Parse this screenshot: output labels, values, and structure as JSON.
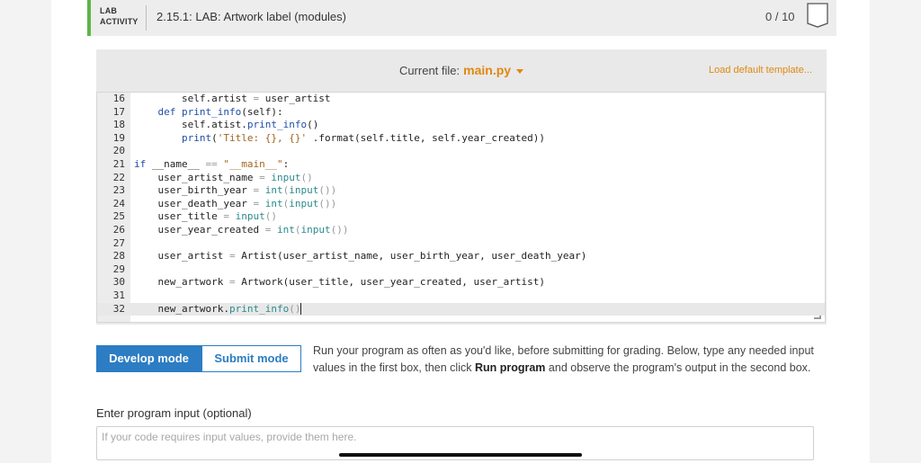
{
  "header": {
    "lab_tag_line1": "LAB",
    "lab_tag_line2": "ACTIVITY",
    "title": "2.15.1: LAB: Artwork label (modules)",
    "score": "0 / 10",
    "accent_color": "#5db548"
  },
  "editor": {
    "current_file_label": "Current file:",
    "file_name": "main.py",
    "load_template": "Load default template...",
    "lines": [
      {
        "n": "16",
        "segs": [
          {
            "t": "        self.artist ",
            "c": ""
          },
          {
            "t": "=",
            "c": "p"
          },
          {
            "t": " user_artist",
            "c": ""
          }
        ]
      },
      {
        "n": "17",
        "segs": [
          {
            "t": "    ",
            "c": ""
          },
          {
            "t": "def",
            "c": "k"
          },
          {
            "t": " ",
            "c": ""
          },
          {
            "t": "print_info",
            "c": "f"
          },
          {
            "t": "(self):",
            "c": ""
          }
        ]
      },
      {
        "n": "18",
        "segs": [
          {
            "t": "        self.atist.",
            "c": ""
          },
          {
            "t": "print_info",
            "c": "f"
          },
          {
            "t": "()",
            "c": ""
          }
        ]
      },
      {
        "n": "19",
        "segs": [
          {
            "t": "        ",
            "c": ""
          },
          {
            "t": "print",
            "c": "k"
          },
          {
            "t": "(",
            "c": ""
          },
          {
            "t": "'Title: {}, {}'",
            "c": "s"
          },
          {
            "t": " .format(self.title, self.year_created))",
            "c": ""
          }
        ]
      },
      {
        "n": "20",
        "segs": []
      },
      {
        "n": "21",
        "segs": [
          {
            "t": "if",
            "c": "k"
          },
          {
            "t": " __name__ ",
            "c": ""
          },
          {
            "t": "==",
            "c": "p"
          },
          {
            "t": " ",
            "c": ""
          },
          {
            "t": "\"__main__\"",
            "c": "s"
          },
          {
            "t": ":",
            "c": ""
          }
        ]
      },
      {
        "n": "22",
        "segs": [
          {
            "t": "    user_artist_name ",
            "c": ""
          },
          {
            "t": "=",
            "c": "p"
          },
          {
            "t": " ",
            "c": ""
          },
          {
            "t": "input",
            "c": "b"
          },
          {
            "t": "()",
            "c": "p"
          }
        ]
      },
      {
        "n": "23",
        "segs": [
          {
            "t": "    user_birth_year ",
            "c": ""
          },
          {
            "t": "=",
            "c": "p"
          },
          {
            "t": " ",
            "c": ""
          },
          {
            "t": "int",
            "c": "b"
          },
          {
            "t": "(",
            "c": "p"
          },
          {
            "t": "input",
            "c": "b"
          },
          {
            "t": "())",
            "c": "p"
          }
        ]
      },
      {
        "n": "24",
        "segs": [
          {
            "t": "    user_death_year ",
            "c": ""
          },
          {
            "t": "=",
            "c": "p"
          },
          {
            "t": " ",
            "c": ""
          },
          {
            "t": "int",
            "c": "b"
          },
          {
            "t": "(",
            "c": "p"
          },
          {
            "t": "input",
            "c": "b"
          },
          {
            "t": "())",
            "c": "p"
          }
        ]
      },
      {
        "n": "25",
        "segs": [
          {
            "t": "    user_title ",
            "c": ""
          },
          {
            "t": "=",
            "c": "p"
          },
          {
            "t": " ",
            "c": ""
          },
          {
            "t": "input",
            "c": "b"
          },
          {
            "t": "()",
            "c": "p"
          }
        ]
      },
      {
        "n": "26",
        "segs": [
          {
            "t": "    user_year_created ",
            "c": ""
          },
          {
            "t": "=",
            "c": "p"
          },
          {
            "t": " ",
            "c": ""
          },
          {
            "t": "int",
            "c": "b"
          },
          {
            "t": "(",
            "c": "p"
          },
          {
            "t": "input",
            "c": "b"
          },
          {
            "t": "())",
            "c": "p"
          }
        ]
      },
      {
        "n": "27",
        "segs": []
      },
      {
        "n": "28",
        "segs": [
          {
            "t": "    user_artist ",
            "c": ""
          },
          {
            "t": "=",
            "c": "p"
          },
          {
            "t": " Artist(user_artist_name, user_birth_year, user_death_year)",
            "c": ""
          }
        ]
      },
      {
        "n": "29",
        "segs": []
      },
      {
        "n": "30",
        "segs": [
          {
            "t": "    new_artwork ",
            "c": ""
          },
          {
            "t": "=",
            "c": "p"
          },
          {
            "t": " Artwork(user_title, user_year_created, user_artist)",
            "c": ""
          }
        ]
      },
      {
        "n": "31",
        "segs": []
      },
      {
        "n": "32",
        "segs": [
          {
            "t": "    new_artwork.",
            "c": ""
          },
          {
            "t": "print_info",
            "c": "b"
          },
          {
            "t": "()",
            "c": "p"
          }
        ],
        "active": true
      }
    ]
  },
  "modes": {
    "develop_label": "Develop mode",
    "submit_label": "Submit mode",
    "active_color": "#2c7dc3"
  },
  "instructions": {
    "part1": "Run your program as often as you'd like, before submitting for grading. Below, type any needed input values in the first box, then click ",
    "bold": "Run program",
    "part2": " and observe the program's output in the second box."
  },
  "program_input": {
    "label": "Enter program input (optional)",
    "placeholder": "If your code requires input values, provide them here.",
    "value": ""
  }
}
